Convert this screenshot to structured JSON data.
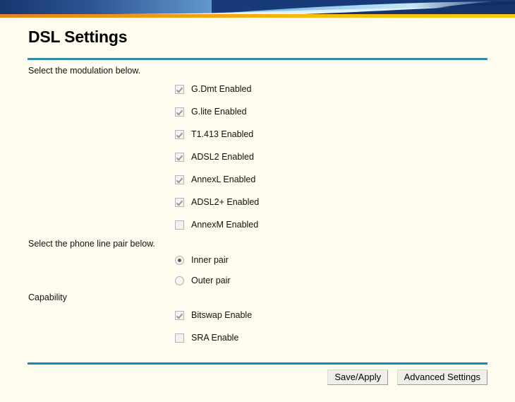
{
  "banner": {
    "name": "decorative-header-banner",
    "colors": {
      "navy_dark": "#13306e",
      "navy_mid": "#28518f",
      "blue_light": "#a9d8f2",
      "blue_pale": "#dcecf8",
      "orange": "#ea8a1e",
      "yellow": "#fcc60c"
    }
  },
  "page": {
    "title": "DSL Settings",
    "background": "#fffdf0",
    "divider_color": "#1a8fb3"
  },
  "labels": {
    "modulation": "Select the modulation below.",
    "line_pair": "Select the phone line pair below.",
    "capability": "Capability"
  },
  "modulation": {
    "options": [
      {
        "label": "G.Dmt Enabled",
        "checked": true
      },
      {
        "label": "G.lite Enabled",
        "checked": true
      },
      {
        "label": "T1.413 Enabled",
        "checked": true
      },
      {
        "label": "ADSL2 Enabled",
        "checked": true
      },
      {
        "label": "AnnexL Enabled",
        "checked": true
      },
      {
        "label": "ADSL2+ Enabled",
        "checked": true
      },
      {
        "label": "AnnexM Enabled",
        "checked": false
      }
    ]
  },
  "line_pair": {
    "options": [
      {
        "label": "Inner pair",
        "selected": true
      },
      {
        "label": "Outer pair",
        "selected": false
      }
    ]
  },
  "capability": {
    "options": [
      {
        "label": "Bitswap Enable",
        "checked": true
      },
      {
        "label": "SRA Enable",
        "checked": false
      }
    ]
  },
  "buttons": {
    "save_apply": "Save/Apply",
    "advanced_settings": "Advanced Settings"
  }
}
